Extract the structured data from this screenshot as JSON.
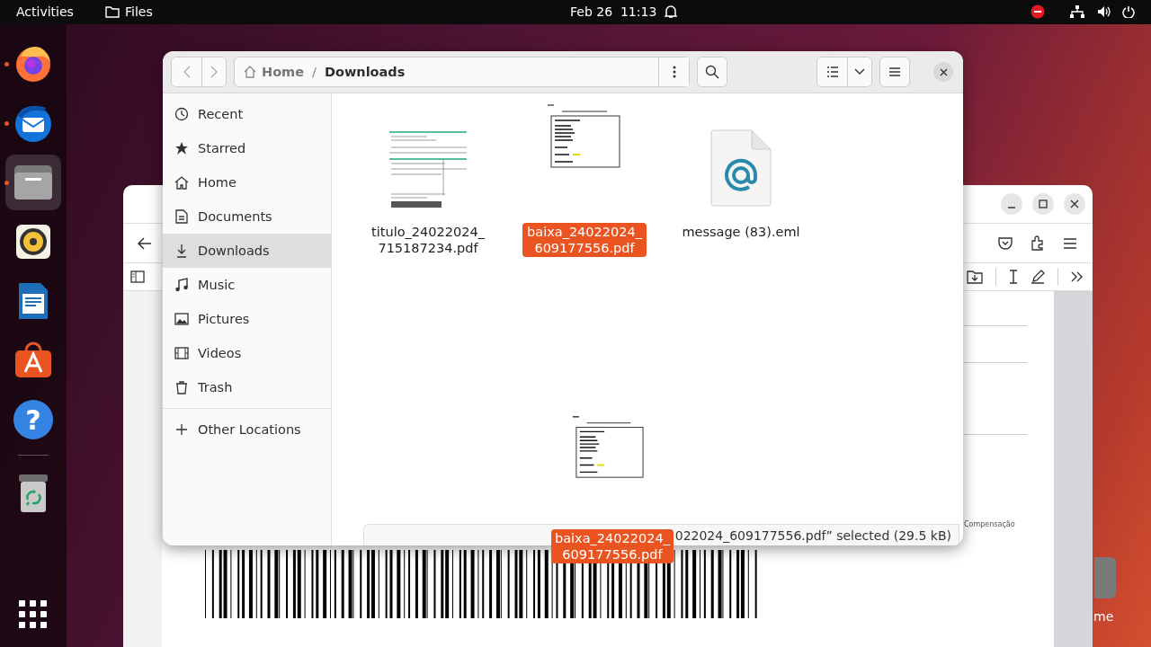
{
  "top_bar": {
    "activities": "Activities",
    "app_name": "Files",
    "datetime": "Feb 26  11:13"
  },
  "dock": [
    {
      "kind": "firefox",
      "running": true,
      "selected": false
    },
    {
      "kind": "thunderbird",
      "running": true,
      "selected": false
    },
    {
      "kind": "files",
      "running": true,
      "selected": true
    },
    {
      "kind": "rhythmbox",
      "running": false,
      "selected": false
    },
    {
      "kind": "writer",
      "running": false,
      "selected": false
    },
    {
      "kind": "appcenter",
      "running": false,
      "selected": false
    },
    {
      "kind": "help",
      "running": false,
      "selected": false,
      "glyph": "?"
    },
    {
      "kind": "trash",
      "running": false,
      "selected": false
    },
    {
      "kind": "apps",
      "running": false,
      "selected": false
    }
  ],
  "desktop_icon": {
    "label": "me"
  },
  "browser_window": {
    "footer_label": "Compensação"
  },
  "files_window": {
    "path_separator": "/",
    "breadcrumb": [
      {
        "label": "Home",
        "selected": false
      },
      {
        "label": "Downloads",
        "selected": true
      }
    ],
    "sidebar": [
      {
        "kind": "recent",
        "label": "Recent",
        "selected": false
      },
      {
        "kind": "starred",
        "label": "Starred",
        "selected": false
      },
      {
        "kind": "home",
        "label": "Home",
        "selected": false
      },
      {
        "kind": "documents",
        "label": "Documents",
        "selected": false
      },
      {
        "kind": "downloads",
        "label": "Downloads",
        "selected": true
      },
      {
        "kind": "music",
        "label": "Music",
        "selected": false
      },
      {
        "kind": "pictures",
        "label": "Pictures",
        "selected": false
      },
      {
        "kind": "videos",
        "label": "Videos",
        "selected": false
      },
      {
        "kind": "trash",
        "label": "Trash",
        "selected": false
      },
      {
        "kind": "other",
        "label": "Other Locations",
        "selected": false
      }
    ],
    "files": [
      {
        "kind": "pdf-slip",
        "name_lines": [
          "titulo_24022024_",
          "715187234.pdf"
        ],
        "selected": false
      },
      {
        "kind": "pdf-form",
        "name_lines": [
          "baixa_24022024_",
          "609177556.pdf"
        ],
        "selected": true
      },
      {
        "kind": "email",
        "name_lines": [
          "message (83).eml"
        ],
        "selected": false
      }
    ],
    "status": "022024_609177556.pdf” selected (29.5 kB)"
  },
  "drag_item": {
    "name_lines": [
      "baixa_24022024_",
      "609177556.pdf"
    ]
  }
}
